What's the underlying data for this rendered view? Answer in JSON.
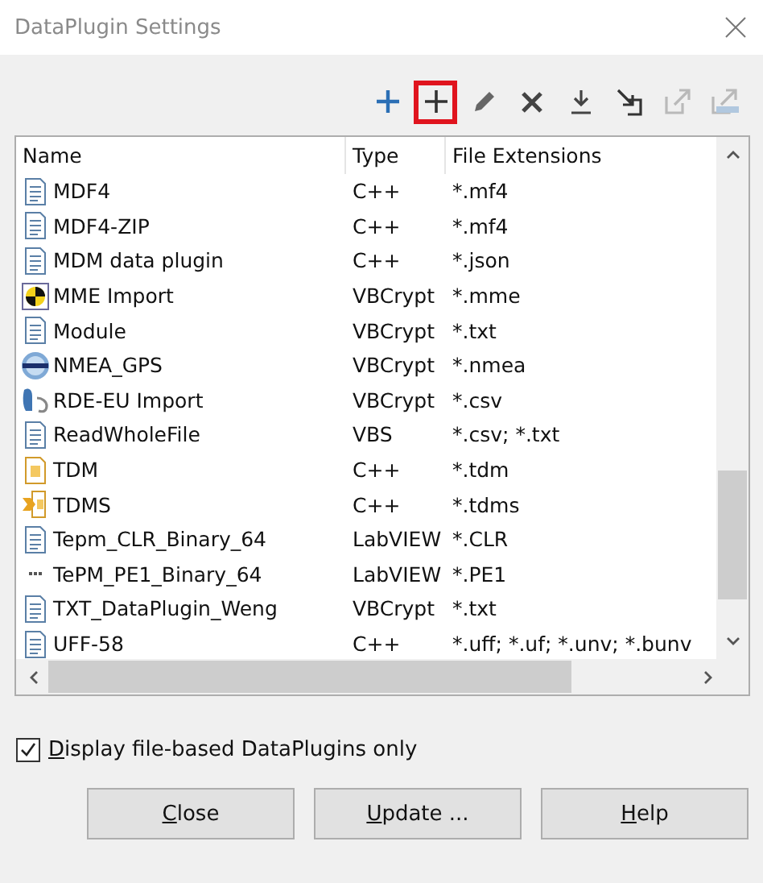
{
  "window": {
    "title": "DataPlugin Settings"
  },
  "toolbar": [
    {
      "kind": "add-blue",
      "disabled": false,
      "highlighted": false
    },
    {
      "kind": "add",
      "disabled": false,
      "highlighted": true
    },
    {
      "kind": "edit",
      "disabled": false,
      "highlighted": false
    },
    {
      "kind": "delete",
      "disabled": false,
      "highlighted": false
    },
    {
      "kind": "download",
      "disabled": false,
      "highlighted": false
    },
    {
      "kind": "import",
      "disabled": false,
      "highlighted": false
    },
    {
      "kind": "export",
      "disabled": true,
      "highlighted": false
    },
    {
      "kind": "export-db",
      "disabled": true,
      "highlighted": false
    }
  ],
  "table": {
    "columns": [
      "Name",
      "Type",
      "File Extensions"
    ],
    "rows": [
      {
        "kind": "doc",
        "name": "MDF4",
        "type": "C++",
        "extensions": "*.mf4"
      },
      {
        "kind": "doc",
        "name": "MDF4-ZIP",
        "type": "C++",
        "extensions": "*.mf4"
      },
      {
        "kind": "doc",
        "name": "MDM data plugin",
        "type": "C++",
        "extensions": "*.json"
      },
      {
        "kind": "crash",
        "name": "MME Import",
        "type": "VBCrypt",
        "extensions": "*.mme"
      },
      {
        "kind": "doc",
        "name": "Module",
        "type": "VBCrypt",
        "extensions": "*.txt"
      },
      {
        "kind": "globe",
        "name": "NMEA_GPS",
        "type": "VBCrypt",
        "extensions": "*.nmea"
      },
      {
        "kind": "rde",
        "name": "RDE-EU Import",
        "type": "VBCrypt",
        "extensions": "*.csv"
      },
      {
        "kind": "doc",
        "name": "ReadWholeFile",
        "type": "VBS",
        "extensions": "*.csv; *.txt"
      },
      {
        "kind": "tdm",
        "name": "TDM",
        "type": "C++",
        "extensions": "*.tdm"
      },
      {
        "kind": "tdms",
        "name": "TDMS",
        "type": "C++",
        "extensions": "*.tdms"
      },
      {
        "kind": "doc",
        "name": "Tepm_CLR_Binary_64",
        "type": "LabVIEW",
        "extensions": "*.CLR"
      },
      {
        "kind": "dots",
        "name": "TePM_PE1_Binary_64",
        "type": "LabVIEW",
        "extensions": "*.PE1"
      },
      {
        "kind": "doc",
        "name": "TXT_DataPlugin_Weng",
        "type": "VBCrypt",
        "extensions": "*.txt"
      },
      {
        "kind": "doc",
        "name": "UFF-58",
        "type": "C++",
        "extensions": "*.uff; *.uf; *.unv; *.bunv"
      }
    ]
  },
  "filter": {
    "label": "Display file-based DataPlugins only",
    "checked": true,
    "mnemonic": true
  },
  "buttons": [
    {
      "label": "Close",
      "mnemonic": true
    },
    {
      "label": "Update ...",
      "mnemonic": true
    },
    {
      "label": "Help",
      "mnemonic": true
    }
  ]
}
